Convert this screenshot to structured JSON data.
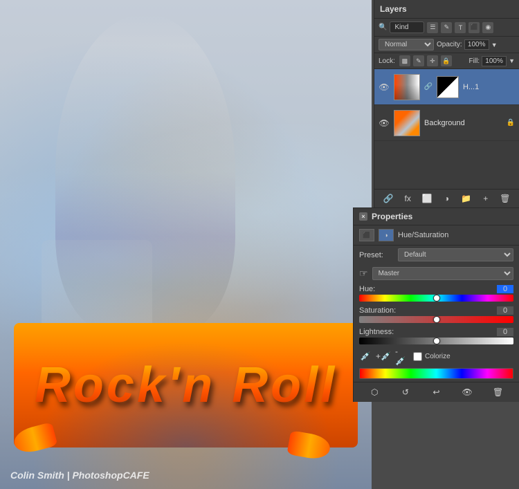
{
  "canvas": {
    "watermark": "Colin Smith | PhotoshopCAFE",
    "rock_text": "Rock'n Roll"
  },
  "layers_panel": {
    "title": "Layers",
    "search_placeholder": "Kind",
    "blend_mode": "Normal",
    "opacity_label": "Opacity:",
    "opacity_value": "100%",
    "lock_label": "Lock:",
    "fill_label": "Fill:",
    "fill_value": "100%",
    "layers": [
      {
        "name": "H...1",
        "visible": true,
        "type": "adjustment",
        "selected": true
      },
      {
        "name": "Background",
        "visible": true,
        "type": "image",
        "selected": false,
        "locked": true
      }
    ],
    "bottom_icons": [
      "link-icon",
      "fx-icon",
      "mask-icon",
      "adjustment-icon",
      "group-icon",
      "delete-icon"
    ]
  },
  "properties_panel": {
    "title": "Properties",
    "close_label": "×",
    "type_label": "Hue/Saturation",
    "preset_label": "Preset:",
    "preset_value": "Default",
    "channel_label": "",
    "channel_value": "Master",
    "hue_label": "Hue:",
    "hue_value": "0",
    "saturation_label": "Saturation:",
    "saturation_value": "0",
    "lightness_label": "Lightness:",
    "lightness_value": "0",
    "colorize_label": "Colorize",
    "hue_slider_pct": 50,
    "saturation_slider_pct": 50,
    "lightness_slider_pct": 50,
    "bottom_icons": [
      "reset-icon",
      "prev-icon",
      "visibility-icon",
      "delete-icon"
    ]
  }
}
